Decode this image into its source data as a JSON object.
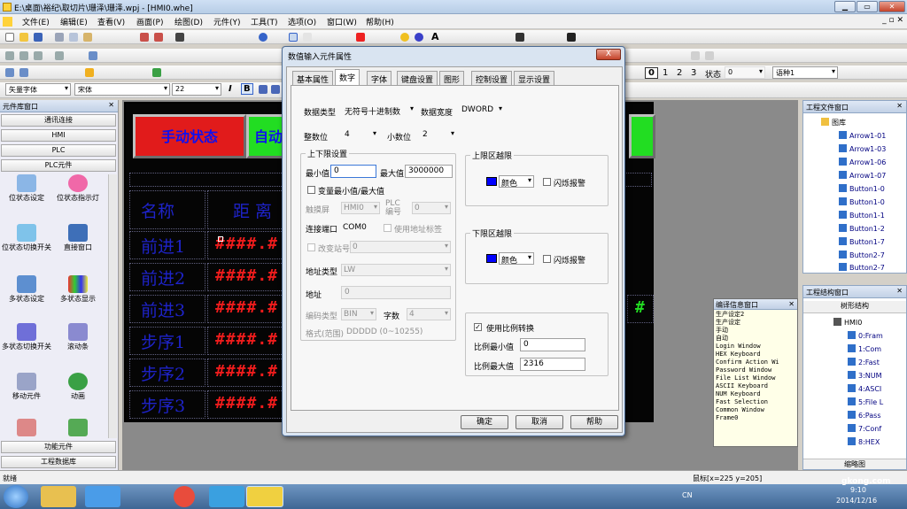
{
  "window": {
    "title": "E:\\桌面\\裕纪\\取切片\\珊泽\\珊泽.wpj - [HMI0.whe]"
  },
  "menu": [
    "文件(E)",
    "编辑(E)",
    "查看(V)",
    "画面(P)",
    "绘图(D)",
    "元件(Y)",
    "工具(T)",
    "选项(O)",
    "窗口(W)",
    "帮助(H)"
  ],
  "toolbar": {
    "font_name": "矢量字体",
    "font_face": "宋体",
    "font_size": "22",
    "state_label": "状态",
    "state_value": "0",
    "lang_value": "语种1",
    "state_numbers": [
      "0",
      "1",
      "2",
      "3"
    ]
  },
  "left_panel": {
    "title": "元件库窗口",
    "categories": [
      "通讯连接",
      "HMI",
      "PLC",
      "PLC元件"
    ],
    "tools": [
      "位状态设定",
      "位状态指示灯",
      "位状态切换开关",
      "直接窗口",
      "多状态设定",
      "多状态显示",
      "多状态切换开关",
      "滚动条",
      "移动元件",
      "动画"
    ],
    "bottom_categories": [
      "功能元件",
      "工程数据库"
    ],
    "colors": {
      "accent": "#2f6fc9"
    }
  },
  "hmi_screen": {
    "buttons": [
      {
        "label": "手动状态",
        "bg": "#e11b1b",
        "fg": "#1010ee"
      },
      {
        "label": "自动",
        "bg": "#22dd22",
        "fg": "#1010ee"
      }
    ],
    "header": [
      "名称",
      "距 离"
    ],
    "rows": [
      "前进1",
      "前进2",
      "前进3",
      "步序1",
      "步序2",
      "步序3"
    ],
    "value_mask": "####.#",
    "right_mark": "#"
  },
  "compile_window": {
    "title": "编译信息窗口",
    "lines": [
      "生产设定2",
      "生产设定",
      "手动",
      "自动",
      "Login Window",
      "HEX Keyboard",
      "Confirm Action Wi",
      "Password Window",
      "File List Window",
      "ASCII Keyboard",
      "NUM Keyboard",
      "Fast Selection",
      "Common Window",
      "Frame0"
    ]
  },
  "file_window": {
    "title": "工程文件窗口",
    "root": "图库",
    "items": [
      "Arrow1-01",
      "Arrow1-03",
      "Arrow1-06",
      "Arrow1-07",
      "Button1-0",
      "Button1-0",
      "Button1-1",
      "Button1-2",
      "Button1-7",
      "Button2-7",
      "Button2-7"
    ]
  },
  "struct_window": {
    "title": "工程结构窗口",
    "tree_header": "树形结构",
    "root": "HMI0",
    "items": [
      "0:Fram",
      "1:Com",
      "2:Fast",
      "3:NUM",
      "4:ASCI",
      "5:File L",
      "6:Pass",
      "7:Conf",
      "8:HEX"
    ],
    "footer": "缩略图"
  },
  "dialog": {
    "title": "数值输入元件属性",
    "close": "X",
    "tabs": [
      "基本属性",
      "数字",
      "字体",
      "键盘设置",
      "图形",
      "控制设置",
      "显示设置"
    ],
    "active_tab": "数字",
    "data_type_label": "数据类型",
    "data_type_value": "无符号十进制数",
    "data_width_label": "数据宽度",
    "data_width_value": "DWORD",
    "int_digits_label": "整数位",
    "int_digits_value": "4",
    "dec_digits_label": "小数位",
    "dec_digits_value": "2",
    "limits_group": "上下限设置",
    "min_label": "最小值",
    "min_value": "0",
    "max_label": "最大值",
    "max_value": "3000000",
    "var_limits_label": "变量最小值/最大值",
    "touch_screen_label": "触摸屏",
    "touch_screen_value": "HMI0",
    "plc_no_label": "PLC 编号",
    "plc_no_value": "0",
    "port_label": "连接端口",
    "port_value": "COM0",
    "use_addr_tag_label": "使用地址标签",
    "change_station_label": "改变站号",
    "change_station_value": "0",
    "addr_type_label": "地址类型",
    "addr_type_value": "LW",
    "addr_label": "地址",
    "addr_value": "0",
    "encode_label": "编码类型",
    "encode_value": "BIN",
    "word_count_label": "字数",
    "word_count_value": "4",
    "format_label": "格式(范围)",
    "format_value": "DDDDD (0~10255)",
    "upper_group": "上限区越限",
    "upper_color_label": "颜色",
    "upper_flash_label": "闪烁报警",
    "lower_group": "下限区越限",
    "lower_color_label": "颜色",
    "lower_flash_label": "闪烁报警",
    "scale_label": "使用比例转换",
    "scale_checked": "✓",
    "scale_min_label": "比例最小值",
    "scale_min_value": "0",
    "scale_max_label": "比例最大值",
    "scale_max_value": "2316",
    "ok": "确定",
    "cancel": "取消",
    "help": "帮助"
  },
  "status": {
    "left": "就绪",
    "mouse": "鼠标[x=225  y=205]"
  },
  "taskbar": {
    "lang": "CN",
    "time": "9:10",
    "date": "2014/12/16",
    "watermark": "gkong.com"
  }
}
